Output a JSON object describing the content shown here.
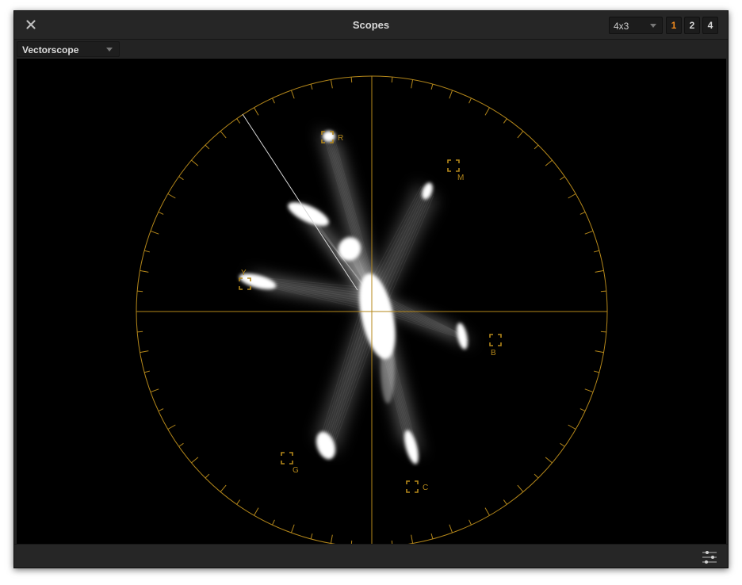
{
  "window": {
    "title": "Scopes"
  },
  "header": {
    "layout": {
      "selected": "4x3"
    },
    "scope_count_buttons": [
      {
        "label": "1",
        "active": true
      },
      {
        "label": "2",
        "active": false
      },
      {
        "label": "4",
        "active": false
      }
    ]
  },
  "toolbar": {
    "scope_type": "Vectorscope"
  },
  "vectorscope": {
    "targets": [
      {
        "label": "R"
      },
      {
        "label": "M"
      },
      {
        "label": "B"
      },
      {
        "label": "C"
      },
      {
        "label": "G"
      },
      {
        "label": "Y"
      }
    ]
  },
  "icons": {
    "close": "close-icon",
    "dropdown": "chevron-down-icon",
    "settings": "sliders-icon"
  },
  "colors": {
    "graticule": "#b4871a",
    "active_accent": "#f08a1e",
    "trace": "#ffffff"
  }
}
